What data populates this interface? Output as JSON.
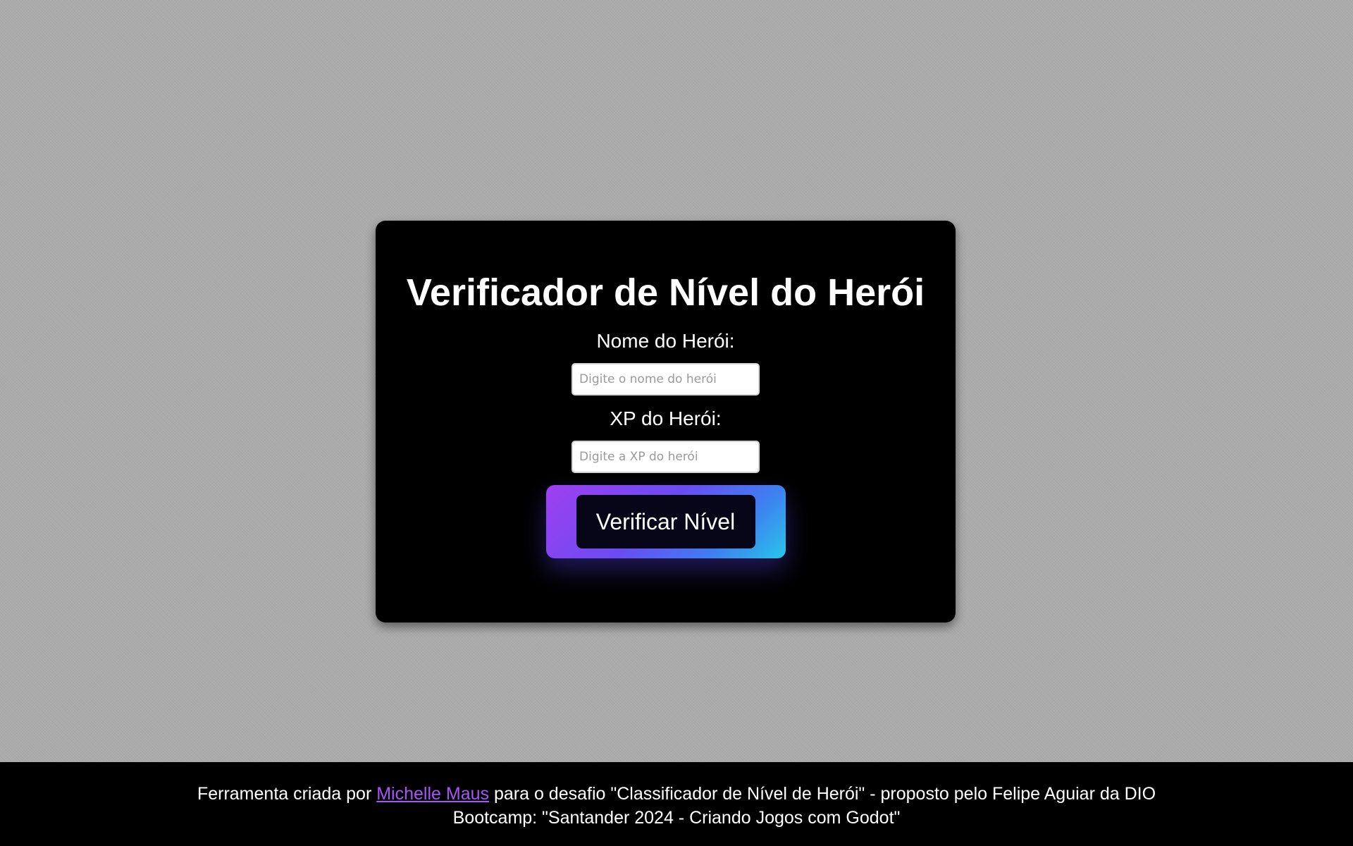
{
  "card": {
    "title": "Verificador de Nível do Herói",
    "name_label": "Nome do Herói:",
    "name_placeholder": "Digite o nome do herói",
    "name_value": "",
    "xp_label": "XP do Herói:",
    "xp_placeholder": "Digite a XP do herói",
    "xp_value": "",
    "verify_button_label": "Verificar Nível"
  },
  "footer": {
    "line1_prefix": "Ferramenta criada por ",
    "author_link": "Michelle Maus",
    "line1_suffix": " para o desafio \"Classificador de Nível de Herói\" - proposto pelo Felipe Aguiar da DIO",
    "line2": "Bootcamp: \"Santander 2024 - Criando Jogos com Godot\""
  },
  "colors": {
    "background": "#acacac",
    "card": "#000000",
    "link": "#a855f7",
    "button_gradient_start": "#a03ff0",
    "button_gradient_end": "#28c6ea",
    "button_inner": "#060618"
  }
}
